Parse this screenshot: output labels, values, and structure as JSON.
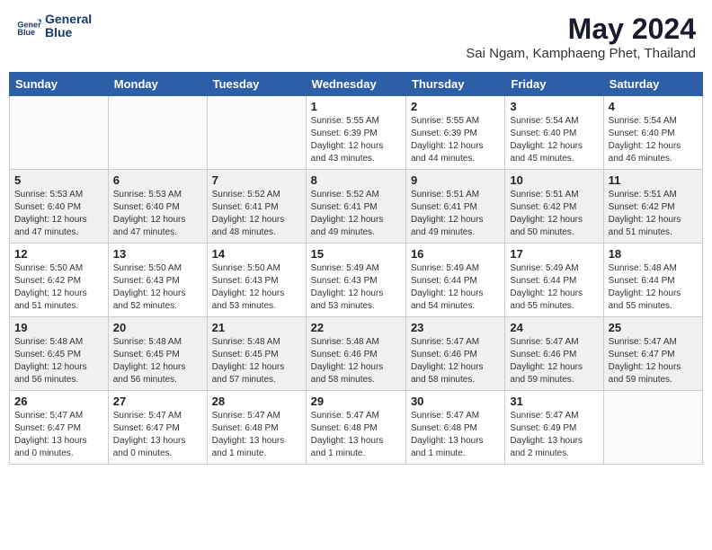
{
  "header": {
    "logo_line1": "General",
    "logo_line2": "Blue",
    "main_title": "May 2024",
    "subtitle": "Sai Ngam, Kamphaeng Phet, Thailand"
  },
  "days_of_week": [
    "Sunday",
    "Monday",
    "Tuesday",
    "Wednesday",
    "Thursday",
    "Friday",
    "Saturday"
  ],
  "weeks": [
    [
      {
        "day": "",
        "info": ""
      },
      {
        "day": "",
        "info": ""
      },
      {
        "day": "",
        "info": ""
      },
      {
        "day": "1",
        "info": "Sunrise: 5:55 AM\nSunset: 6:39 PM\nDaylight: 12 hours\nand 43 minutes."
      },
      {
        "day": "2",
        "info": "Sunrise: 5:55 AM\nSunset: 6:39 PM\nDaylight: 12 hours\nand 44 minutes."
      },
      {
        "day": "3",
        "info": "Sunrise: 5:54 AM\nSunset: 6:40 PM\nDaylight: 12 hours\nand 45 minutes."
      },
      {
        "day": "4",
        "info": "Sunrise: 5:54 AM\nSunset: 6:40 PM\nDaylight: 12 hours\nand 46 minutes."
      }
    ],
    [
      {
        "day": "5",
        "info": "Sunrise: 5:53 AM\nSunset: 6:40 PM\nDaylight: 12 hours\nand 47 minutes."
      },
      {
        "day": "6",
        "info": "Sunrise: 5:53 AM\nSunset: 6:40 PM\nDaylight: 12 hours\nand 47 minutes."
      },
      {
        "day": "7",
        "info": "Sunrise: 5:52 AM\nSunset: 6:41 PM\nDaylight: 12 hours\nand 48 minutes."
      },
      {
        "day": "8",
        "info": "Sunrise: 5:52 AM\nSunset: 6:41 PM\nDaylight: 12 hours\nand 49 minutes."
      },
      {
        "day": "9",
        "info": "Sunrise: 5:51 AM\nSunset: 6:41 PM\nDaylight: 12 hours\nand 49 minutes."
      },
      {
        "day": "10",
        "info": "Sunrise: 5:51 AM\nSunset: 6:42 PM\nDaylight: 12 hours\nand 50 minutes."
      },
      {
        "day": "11",
        "info": "Sunrise: 5:51 AM\nSunset: 6:42 PM\nDaylight: 12 hours\nand 51 minutes."
      }
    ],
    [
      {
        "day": "12",
        "info": "Sunrise: 5:50 AM\nSunset: 6:42 PM\nDaylight: 12 hours\nand 51 minutes."
      },
      {
        "day": "13",
        "info": "Sunrise: 5:50 AM\nSunset: 6:43 PM\nDaylight: 12 hours\nand 52 minutes."
      },
      {
        "day": "14",
        "info": "Sunrise: 5:50 AM\nSunset: 6:43 PM\nDaylight: 12 hours\nand 53 minutes."
      },
      {
        "day": "15",
        "info": "Sunrise: 5:49 AM\nSunset: 6:43 PM\nDaylight: 12 hours\nand 53 minutes."
      },
      {
        "day": "16",
        "info": "Sunrise: 5:49 AM\nSunset: 6:44 PM\nDaylight: 12 hours\nand 54 minutes."
      },
      {
        "day": "17",
        "info": "Sunrise: 5:49 AM\nSunset: 6:44 PM\nDaylight: 12 hours\nand 55 minutes."
      },
      {
        "day": "18",
        "info": "Sunrise: 5:48 AM\nSunset: 6:44 PM\nDaylight: 12 hours\nand 55 minutes."
      }
    ],
    [
      {
        "day": "19",
        "info": "Sunrise: 5:48 AM\nSunset: 6:45 PM\nDaylight: 12 hours\nand 56 minutes."
      },
      {
        "day": "20",
        "info": "Sunrise: 5:48 AM\nSunset: 6:45 PM\nDaylight: 12 hours\nand 56 minutes."
      },
      {
        "day": "21",
        "info": "Sunrise: 5:48 AM\nSunset: 6:45 PM\nDaylight: 12 hours\nand 57 minutes."
      },
      {
        "day": "22",
        "info": "Sunrise: 5:48 AM\nSunset: 6:46 PM\nDaylight: 12 hours\nand 58 minutes."
      },
      {
        "day": "23",
        "info": "Sunrise: 5:47 AM\nSunset: 6:46 PM\nDaylight: 12 hours\nand 58 minutes."
      },
      {
        "day": "24",
        "info": "Sunrise: 5:47 AM\nSunset: 6:46 PM\nDaylight: 12 hours\nand 59 minutes."
      },
      {
        "day": "25",
        "info": "Sunrise: 5:47 AM\nSunset: 6:47 PM\nDaylight: 12 hours\nand 59 minutes."
      }
    ],
    [
      {
        "day": "26",
        "info": "Sunrise: 5:47 AM\nSunset: 6:47 PM\nDaylight: 13 hours\nand 0 minutes."
      },
      {
        "day": "27",
        "info": "Sunrise: 5:47 AM\nSunset: 6:47 PM\nDaylight: 13 hours\nand 0 minutes."
      },
      {
        "day": "28",
        "info": "Sunrise: 5:47 AM\nSunset: 6:48 PM\nDaylight: 13 hours\nand 1 minute."
      },
      {
        "day": "29",
        "info": "Sunrise: 5:47 AM\nSunset: 6:48 PM\nDaylight: 13 hours\nand 1 minute."
      },
      {
        "day": "30",
        "info": "Sunrise: 5:47 AM\nSunset: 6:48 PM\nDaylight: 13 hours\nand 1 minute."
      },
      {
        "day": "31",
        "info": "Sunrise: 5:47 AM\nSunset: 6:49 PM\nDaylight: 13 hours\nand 2 minutes."
      },
      {
        "day": "",
        "info": ""
      }
    ]
  ]
}
